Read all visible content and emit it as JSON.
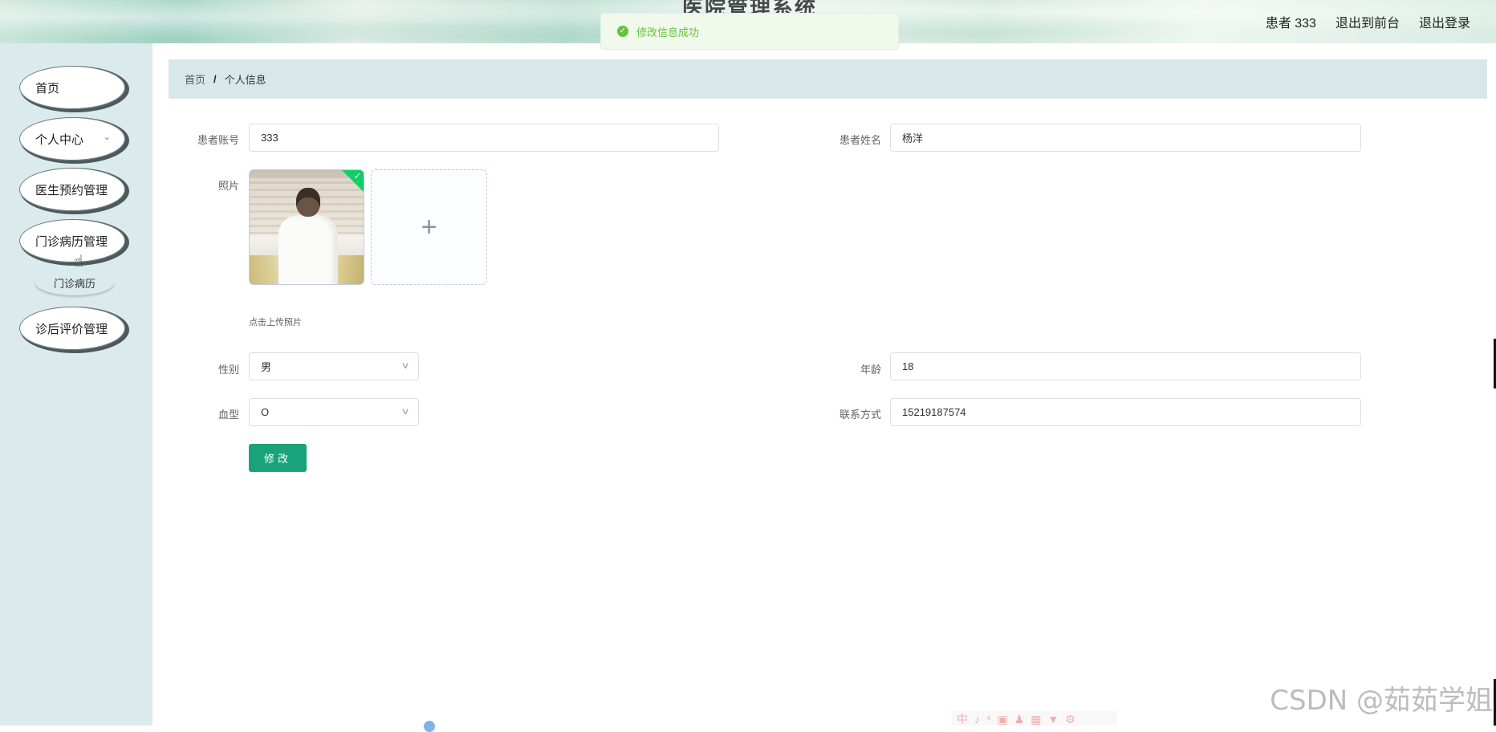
{
  "header": {
    "system_title": "医院管理系统",
    "user_label": "患者 333",
    "back_to_front": "退出到前台",
    "logout": "退出登录"
  },
  "toast": {
    "message": "修改信息成功"
  },
  "sidebar": {
    "items": [
      {
        "label": "首页"
      },
      {
        "label": "个人中心"
      },
      {
        "label": "医生预约管理"
      },
      {
        "label": "门诊病历管理"
      },
      {
        "label": "诊后评价管理"
      }
    ],
    "submenu": {
      "label": "门诊病历"
    }
  },
  "breadcrumb": {
    "home": "首页",
    "separator": "/",
    "current": "个人信息"
  },
  "form": {
    "account_label": "患者账号",
    "account_value": "333",
    "name_label": "患者姓名",
    "name_value": "杨洋",
    "photo_label": "照片",
    "upload_plus": "+",
    "upload_hint": "点击上传照片",
    "gender_label": "性别",
    "gender_value": "男",
    "age_label": "年龄",
    "age_value": "18",
    "blood_label": "血型",
    "blood_value": "O",
    "phone_label": "联系方式",
    "phone_value": "15219187574",
    "submit_label": "修改"
  },
  "watermark": "CSDN @茹茹学姐",
  "ime_toolbar": "中 ♪ ⁴ ▣ ♟ ▦ ▼ ⚙",
  "colors": {
    "primary_button": "#1aa37a",
    "sidebar_bg": "#dbeaec",
    "breadcrumb_bg": "#d8e8ea",
    "toast_text": "#67c23a",
    "toast_bg": "#f0f9eb"
  },
  "icons": {
    "toast": "check-circle-icon",
    "dropdown": "chevron-down-icon",
    "upload": "plus-icon",
    "uploaded_badge": "check-icon"
  }
}
